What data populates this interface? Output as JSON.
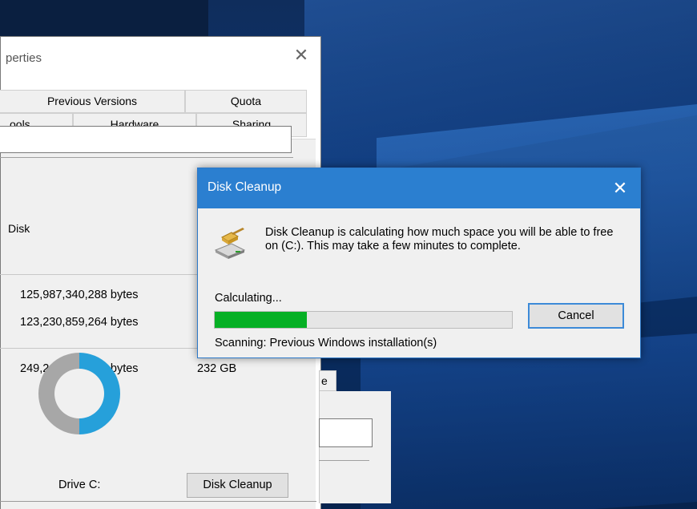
{
  "properties_window": {
    "title_partial": "perties",
    "close_glyph": "✕",
    "tabs_row1": [
      "Previous Versions",
      "Quota"
    ],
    "tabs_row2": [
      "ools",
      "Hardware",
      "Sharing"
    ],
    "type_label_partial": "Disk",
    "used_bytes": "125,987,340,288 bytes",
    "free_bytes": "123,230,859,264 bytes",
    "capacity_bytes": "249,218,199,552 bytes",
    "capacity_gb": "232 GB",
    "drive_label": "Drive C:",
    "disk_cleanup_button": "Disk Cleanup",
    "partial_tab_label": "e",
    "usage_chart": {
      "used_color": "#26a0da",
      "free_color": "#a7a7a7"
    }
  },
  "disk_cleanup_dialog": {
    "title": "Disk Cleanup",
    "close_glyph": "✕",
    "icon": "disk-cleanup-broom-icon",
    "message": "Disk Cleanup is calculating how much space you will be able to free on  (C:). This may take a few minutes to complete.",
    "status": "Calculating...",
    "progress_fraction": 0.31,
    "cancel_label": "Cancel",
    "scanning_text": "Scanning:  Previous Windows installation(s)",
    "accent_color": "#2b7fd0",
    "progress_color": "#06b025"
  }
}
